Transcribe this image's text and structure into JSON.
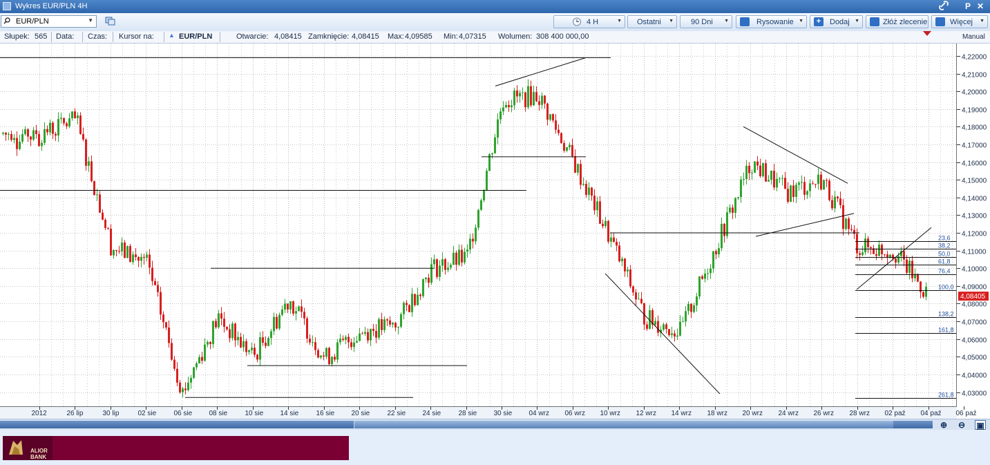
{
  "window": {
    "title": "Wykres EUR/PLN 4H"
  },
  "toolbar": {
    "symbol_value": "EUR/PLN",
    "interval_label": "4 H",
    "range_mode_label": "Ostatni",
    "range_value_label": "90 Dni",
    "drawing_label": "Rysowanie",
    "add_label": "Dodaj",
    "order_label": "Złóż zlecenie",
    "more_label": "Więcej"
  },
  "window_controls": {
    "pin": "P",
    "close": "✕"
  },
  "infobar": {
    "bar_label": "Słupek:",
    "bar_value": "565",
    "date_label": "Data:",
    "time_label": "Czas:",
    "cursor_label": "Kursor na:",
    "instrument": "EUR/PLN",
    "open_label": "Otwarcie:",
    "open_value": "4,08415",
    "close_label": "Zamknięcie:",
    "close_value": "4,08415",
    "max_label": "Max:",
    "max_value": "4,09585",
    "min_label": "Min:",
    "min_value": "4,07315",
    "volume_label": "Wolumen:",
    "volume_value": "308 400 000,00",
    "mode": "Manual"
  },
  "colors": {
    "up": "#2ea32e",
    "down": "#d81f1f",
    "grid": "#8f8f8f",
    "price_tag": "#d81f1f"
  },
  "chart_data": {
    "type": "candlestick",
    "instrument": "EUR/PLN",
    "interval": "4 H",
    "ylim": [
      4.022,
      4.227
    ],
    "y_ticks": [
      "4,03000",
      "4,04000",
      "4,05000",
      "4,06000",
      "4,07000",
      "4,08000",
      "4,09000",
      "4,10000",
      "4,11000",
      "4,12000",
      "4,13000",
      "4,14000",
      "4,15000",
      "4,16000",
      "4,17000",
      "4,18000",
      "4,19000",
      "4,20000",
      "4,21000",
      "4,22000"
    ],
    "x_ticks": [
      "2012",
      "26 lip",
      "30 lip",
      "02 sie",
      "06 sie",
      "08 sie",
      "10 sie",
      "14 sie",
      "16 sie",
      "20 sie",
      "22 sie",
      "24 sie",
      "28 sie",
      "30 sie",
      "04 wrz",
      "06 wrz",
      "10 wrz",
      "12 wrz",
      "14 wrz",
      "18 wrz",
      "20 wrz",
      "24 wrz",
      "26 wrz",
      "28 wrz",
      "02 paź",
      "04 paź",
      "06 paź"
    ],
    "last_price": "4,08405",
    "last_price_value": 4.08405,
    "key_closes": [
      {
        "date": "2012",
        "close": 4.176
      },
      {
        "date": "26 lip",
        "close": 4.184
      },
      {
        "date": "30 lip",
        "close": 4.112
      },
      {
        "date": "02 sie",
        "close": 4.103
      },
      {
        "date": "06 sie",
        "close": 4.03
      },
      {
        "date": "08 sie",
        "close": 4.072
      },
      {
        "date": "10 sie",
        "close": 4.05
      },
      {
        "date": "14 sie",
        "close": 4.083
      },
      {
        "date": "16 sie",
        "close": 4.049
      },
      {
        "date": "20 sie",
        "close": 4.064
      },
      {
        "date": "22 sie",
        "close": 4.068
      },
      {
        "date": "24 sie",
        "close": 4.1
      },
      {
        "date": "28 sie",
        "close": 4.106
      },
      {
        "date": "30 sie",
        "close": 4.195
      },
      {
        "date": "04 wrz",
        "close": 4.198
      },
      {
        "date": "06 wrz",
        "close": 4.16
      },
      {
        "date": "10 wrz",
        "close": 4.118
      },
      {
        "date": "12 wrz",
        "close": 4.072
      },
      {
        "date": "14 wrz",
        "close": 4.064
      },
      {
        "date": "18 wrz",
        "close": 4.112
      },
      {
        "date": "20 wrz",
        "close": 4.16
      },
      {
        "date": "24 wrz",
        "close": 4.143
      },
      {
        "date": "26 wrz",
        "close": 4.15
      },
      {
        "date": "28 wrz",
        "close": 4.112
      },
      {
        "date": "02 paź",
        "close": 4.11
      },
      {
        "date": "04 paź",
        "close": 4.084
      }
    ],
    "fibonacci_levels": [
      "23,6",
      "38,2",
      "50,0",
      "61,8",
      "76,4",
      "100,0",
      "138,2",
      "161,8",
      "261,8"
    ],
    "horizontal_levels": [
      4.219,
      4.144,
      4.163,
      4.1,
      4.045,
      4.027,
      4.12
    ]
  }
}
